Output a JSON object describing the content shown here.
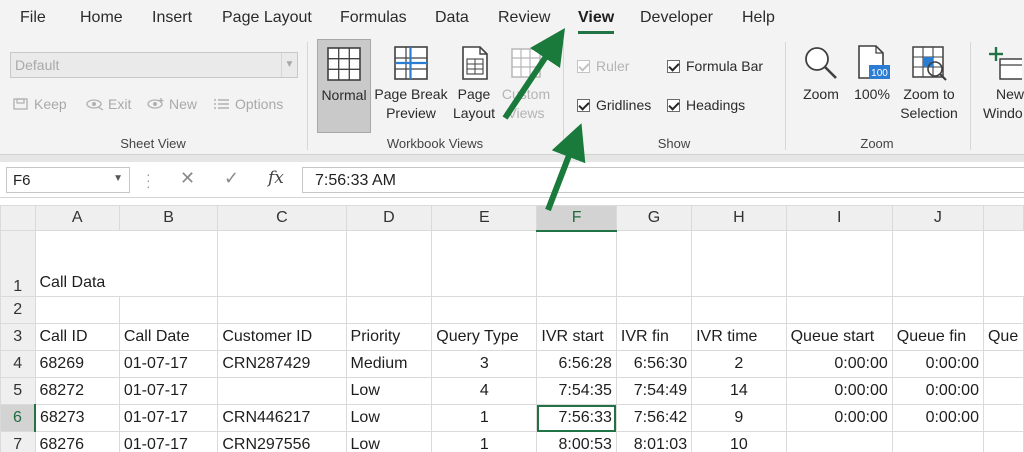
{
  "menu": [
    "File",
    "Home",
    "Insert",
    "Page Layout",
    "Formulas",
    "Data",
    "Review",
    "View",
    "Developer",
    "Help"
  ],
  "sheet_view": {
    "combo_value": "Default",
    "keep": "Keep",
    "exit": "Exit",
    "new": "New",
    "options": "Options",
    "label": "Sheet View"
  },
  "workbook_views": {
    "normal": "Normal",
    "page_break_1": "Page Break",
    "page_break_2": "Preview",
    "page_layout_1": "Page",
    "page_layout_2": "Layout",
    "custom_1": "Custom",
    "custom_2": "Views",
    "label": "Workbook Views"
  },
  "show": {
    "ruler": "Ruler",
    "formula_bar": "Formula Bar",
    "gridlines": "Gridlines",
    "headings": "Headings",
    "label": "Show"
  },
  "zoom": {
    "zoom": "Zoom",
    "hundred": "100%",
    "hundred_icon_text": "100",
    "zoom_sel_1": "Zoom to",
    "zoom_sel_2": "Selection",
    "label": "Zoom"
  },
  "window": {
    "new_1": "New",
    "new_2": "Windo"
  },
  "formula_bar": {
    "name_box": "F6",
    "fx": "fx",
    "value": "7:56:33 AM"
  },
  "columns": [
    "A",
    "B",
    "C",
    "D",
    "E",
    "F",
    "G",
    "H",
    "I",
    "J",
    ""
  ],
  "rows": [
    {
      "n": "1",
      "cells": [
        "Call Data",
        "",
        "",
        "",
        "",
        "",
        "",
        "",
        "",
        "",
        ""
      ]
    },
    {
      "n": "2",
      "cells": [
        "",
        "",
        "",
        "",
        "",
        "",
        "",
        "",
        "",
        "",
        ""
      ]
    },
    {
      "n": "3",
      "cells": [
        "Call ID",
        "Call Date",
        "Customer ID",
        "Priority",
        "Query Type",
        "IVR start",
        "IVR fin",
        "IVR time",
        "Queue start",
        "Queue fin",
        "Que"
      ]
    },
    {
      "n": "4",
      "cells": [
        "68269",
        "01-07-17",
        "CRN287429",
        "Medium",
        "3",
        "6:56:28",
        "6:56:30",
        "2",
        "0:00:00",
        "0:00:00",
        ""
      ]
    },
    {
      "n": "5",
      "cells": [
        "68272",
        "01-07-17",
        "",
        "Low",
        "4",
        "7:54:35",
        "7:54:49",
        "14",
        "0:00:00",
        "0:00:00",
        ""
      ]
    },
    {
      "n": "6",
      "cells": [
        "68273",
        "01-07-17",
        "CRN446217",
        "Low",
        "1",
        "7:56:33",
        "7:56:42",
        "9",
        "0:00:00",
        "0:00:00",
        ""
      ]
    },
    {
      "n": "7",
      "cells": [
        "68276",
        "01-07-17",
        "CRN297556",
        "Low",
        "1",
        "8:00:53",
        "8:01:03",
        "10",
        "",
        "",
        ""
      ]
    }
  ],
  "selected": {
    "col": "F",
    "row": "6"
  },
  "colors": {
    "accent": "#217346",
    "arrow": "#1a7a3c"
  }
}
